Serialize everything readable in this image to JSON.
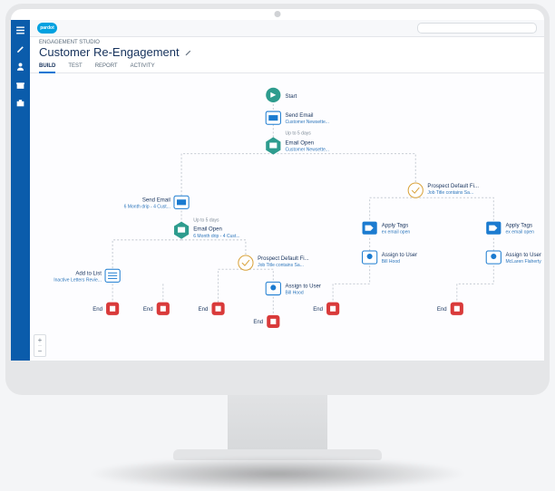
{
  "app": {
    "product": "pardot",
    "breadcrumb": "ENGAGEMENT STUDIO",
    "title": "Customer Re-Engagement"
  },
  "tabs": [
    {
      "label": "BUILD",
      "active": true
    },
    {
      "label": "TEST",
      "active": false
    },
    {
      "label": "REPORT",
      "active": false
    },
    {
      "label": "ACTIVITY",
      "active": false
    }
  ],
  "sidebar_icons": [
    "menu-icon",
    "edit-icon",
    "user-icon",
    "gift-icon",
    "briefcase-icon"
  ],
  "zoom": {
    "plus": "+",
    "minus": "−"
  },
  "nodes": {
    "start": {
      "label": "Start"
    },
    "se1": {
      "label": "Send Email",
      "sub": "Customer Newsette..."
    },
    "eo1": {
      "label": "Email Open",
      "hint": "Up to 5 days",
      "sub": "Customer Newsette..."
    },
    "se2": {
      "label": "Send Email",
      "sub": "6 Month drip - 4 Cust..."
    },
    "eo2": {
      "label": "Email Open",
      "hint": "Up to 5 days",
      "sub": "6 Month drip - 4 Cust..."
    },
    "atl": {
      "label": "Add to List",
      "sub": "Inactive Letters Revie..."
    },
    "pd1": {
      "label": "Prospect Default Fi...",
      "sub": "Job Title contains Sa..."
    },
    "au1": {
      "label": "Assign to User",
      "sub": "Bill Hood"
    },
    "pd2": {
      "label": "Prospect Default Fi...",
      "sub": "Job Title contains Sa..."
    },
    "at1": {
      "label": "Apply Tags",
      "sub": "ex email open"
    },
    "au2": {
      "label": "Assign to User",
      "sub": "Bill Hood"
    },
    "at2": {
      "label": "Apply Tags",
      "sub": "ex email open"
    },
    "au3": {
      "label": "Assign to User",
      "sub": "McLaren Flaherty"
    },
    "end": {
      "label": "End"
    }
  }
}
